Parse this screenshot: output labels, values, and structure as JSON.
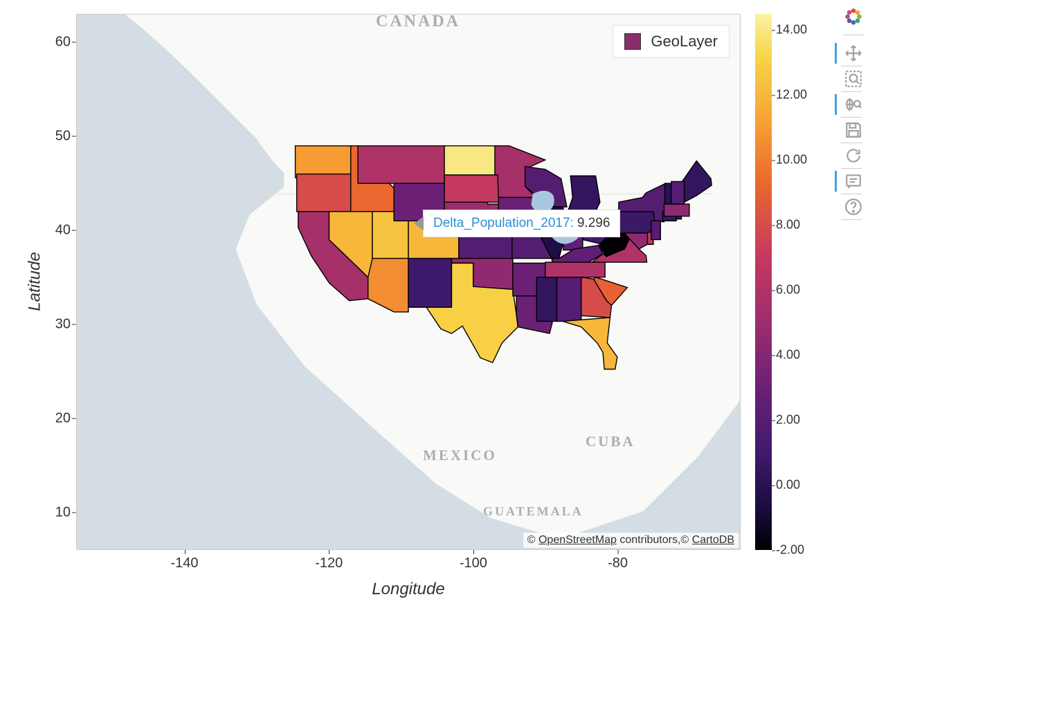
{
  "axes": {
    "x_label": "Longitude",
    "y_label": "Latitude",
    "x_ticks": [
      -140,
      -120,
      -100,
      -80
    ],
    "y_ticks": [
      10,
      20,
      30,
      40,
      50,
      60
    ],
    "x_range": [
      -155,
      -63
    ],
    "y_range": [
      6,
      63
    ]
  },
  "legend": {
    "label": "GeoLayer"
  },
  "tooltip": {
    "key": "Delta_Population_2017:",
    "value": "9.296"
  },
  "colorbar": {
    "ticks": [
      14.0,
      12.0,
      10.0,
      8.0,
      6.0,
      4.0,
      2.0,
      0.0,
      -2.0
    ],
    "range": [
      -2.0,
      14.5
    ]
  },
  "attribution": {
    "prefix": "© ",
    "osm": "OpenStreetMap",
    "mid": " contributors,© ",
    "carto": "CartoDB"
  },
  "map_labels": {
    "canada": "CANADA",
    "mexico": "MEXICO",
    "cuba": "CUBA",
    "guatemala": "GUATEMALA"
  },
  "toolbar": {
    "items": [
      {
        "name": "pan",
        "active": true
      },
      {
        "name": "box-zoom",
        "active": false
      },
      {
        "name": "wheel-zoom",
        "active": true
      },
      {
        "name": "save",
        "active": false
      },
      {
        "name": "reset",
        "active": false
      },
      {
        "name": "hover",
        "active": true
      },
      {
        "name": "help",
        "active": false
      }
    ]
  },
  "chart_data": {
    "type": "choropleth",
    "title": "",
    "value_label": "Delta_Population_2017",
    "color_scale": "inferno",
    "color_range": [
      -2.0,
      14.5
    ],
    "xlabel": "Longitude",
    "ylabel": "Latitude",
    "x_range": [
      -155,
      -63
    ],
    "y_range": [
      6,
      63
    ],
    "hovered_state": "Idaho",
    "hovered_value": 9.296,
    "states": [
      {
        "state": "Washington",
        "value": 11.0
      },
      {
        "state": "Oregon",
        "value": 8.0
      },
      {
        "state": "California",
        "value": 5.5
      },
      {
        "state": "Idaho",
        "value": 9.296
      },
      {
        "state": "Nevada",
        "value": 12.0
      },
      {
        "state": "Montana",
        "value": 6.0
      },
      {
        "state": "Wyoming",
        "value": 3.0
      },
      {
        "state": "Utah",
        "value": 12.5
      },
      {
        "state": "Colorado",
        "value": 12.0
      },
      {
        "state": "Arizona",
        "value": 10.5
      },
      {
        "state": "New Mexico",
        "value": 1.0
      },
      {
        "state": "North Dakota",
        "value": 14.0
      },
      {
        "state": "South Dakota",
        "value": 7.0
      },
      {
        "state": "Nebraska",
        "value": 5.0
      },
      {
        "state": "Kansas",
        "value": 2.0
      },
      {
        "state": "Oklahoma",
        "value": 4.5
      },
      {
        "state": "Texas",
        "value": 13.0
      },
      {
        "state": "Minnesota",
        "value": 5.5
      },
      {
        "state": "Iowa",
        "value": 3.0
      },
      {
        "state": "Missouri",
        "value": 2.0
      },
      {
        "state": "Arkansas",
        "value": 3.0
      },
      {
        "state": "Louisiana",
        "value": 3.0
      },
      {
        "state": "Wisconsin",
        "value": 2.0
      },
      {
        "state": "Illinois",
        "value": -0.5
      },
      {
        "state": "Mississippi",
        "value": 0.5
      },
      {
        "state": "Michigan",
        "value": 0.5
      },
      {
        "state": "Indiana",
        "value": 2.5
      },
      {
        "state": "Ohio",
        "value": 1.0
      },
      {
        "state": "Kentucky",
        "value": 2.5
      },
      {
        "state": "Tennessee",
        "value": 6.0
      },
      {
        "state": "Alabama",
        "value": 2.0
      },
      {
        "state": "West Virginia",
        "value": -2.0
      },
      {
        "state": "Virginia",
        "value": 6.0
      },
      {
        "state": "North Carolina",
        "value": 8.0
      },
      {
        "state": "South Carolina",
        "value": 9.0
      },
      {
        "state": "Georgia",
        "value": 8.0
      },
      {
        "state": "Florida",
        "value": 12.0
      },
      {
        "state": "Pennsylvania",
        "value": 0.8
      },
      {
        "state": "New York",
        "value": 2.0
      },
      {
        "state": "Maryland",
        "value": 4.5
      },
      {
        "state": "Delaware",
        "value": 7.0
      },
      {
        "state": "New Jersey",
        "value": 2.0
      },
      {
        "state": "Connecticut",
        "value": 0.5
      },
      {
        "state": "Rhode Island",
        "value": 0.5
      },
      {
        "state": "Massachusetts",
        "value": 4.5
      },
      {
        "state": "Vermont",
        "value": 0.0
      },
      {
        "state": "New Hampshire",
        "value": 2.0
      },
      {
        "state": "Maine",
        "value": 0.5
      }
    ]
  }
}
